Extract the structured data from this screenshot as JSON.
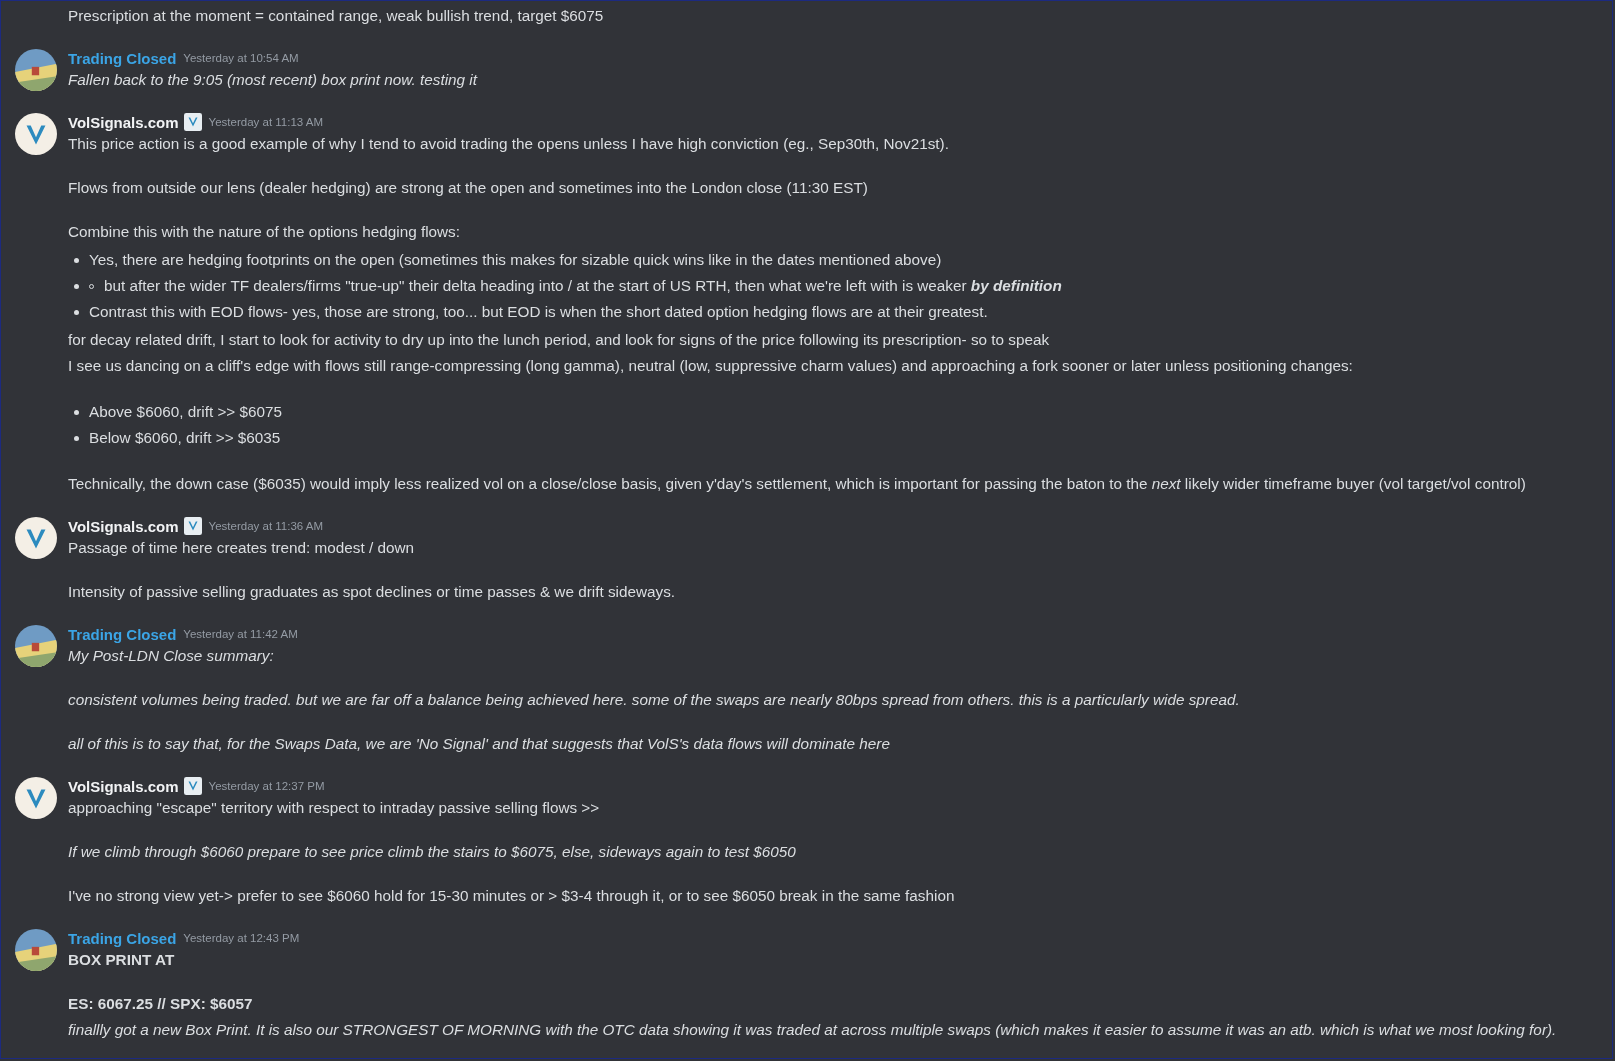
{
  "messages": [
    {
      "blocks": [
        {
          "kind": "plain",
          "text": "Prescription at the moment = contained range, weak bullish trend, target $6075"
        }
      ]
    },
    {
      "author": "Trading Closed",
      "color": "#3ba5e6",
      "verified": false,
      "time": "Yesterday at 10:54 AM",
      "blocks": [
        {
          "kind": "italic",
          "text": "Fallen back to the 9:05 (most recent) box print now. testing it"
        }
      ]
    },
    {
      "author": "VolSignals.com",
      "color": "#f2f3f5",
      "verified": true,
      "time": "Yesterday at 11:13 AM",
      "blocks": [
        {
          "kind": "plain",
          "text": "This price action is a good example of why I tend to avoid trading the opens unless I have high conviction (eg., Sep30th, Nov21st)."
        },
        {
          "kind": "gap"
        },
        {
          "kind": "plain",
          "text": "Flows from outside our lens (dealer hedging) are strong at the open and sometimes into the London close (11:30 EST)"
        },
        {
          "kind": "gap"
        },
        {
          "kind": "plain",
          "text": "Combine this with the nature of the options hedging flows:"
        },
        {
          "kind": "list",
          "items": [
            {
              "nested": false,
              "text": "Yes, there are hedging footprints on the open (sometimes this makes for sizable quick wins like in the dates mentioned above)"
            },
            {
              "nested": true,
              "text": "but after the wider TF dealers/firms \"true-up\" their delta heading into / at the start of US RTH, then what we're left with is weaker **by definition**"
            },
            {
              "nested": false,
              "text": "Contrast this with EOD flows- yes, those are strong, too... but EOD is when the short dated option hedging flows are at their greatest."
            }
          ]
        },
        {
          "kind": "plain",
          "text": "for decay related drift, I start to look for activity to dry up into the lunch period, and look for signs of the price following its prescription- so to speak"
        },
        {
          "kind": "plain",
          "text": "I see us dancing on a cliff's edge with flows still range-compressing (long gamma), neutral (low, suppressive charm values) and approaching a fork sooner or later unless positioning changes:"
        },
        {
          "kind": "gap"
        },
        {
          "kind": "list",
          "items": [
            {
              "nested": false,
              "text": "Above $6060, drift >> $6075"
            },
            {
              "nested": false,
              "text": "Below $6060, drift >> $6035"
            }
          ]
        },
        {
          "kind": "gap"
        },
        {
          "kind": "plain",
          "text": "Technically, the down case ($6035) would imply less realized vol on a close/close basis, given y'day's settlement, which is important for passing the baton to the *next* likely wider timeframe buyer (vol target/vol control)"
        }
      ]
    },
    {
      "author": "VolSignals.com",
      "color": "#f2f3f5",
      "verified": true,
      "time": "Yesterday at 11:36 AM",
      "blocks": [
        {
          "kind": "plain",
          "text": "Passage of time here creates trend: modest / down"
        },
        {
          "kind": "gap"
        },
        {
          "kind": "plain",
          "text": "Intensity of passive selling graduates as spot declines or time passes & we drift sideways."
        }
      ]
    },
    {
      "author": "Trading Closed",
      "color": "#3ba5e6",
      "verified": false,
      "time": "Yesterday at 11:42 AM",
      "blocks": [
        {
          "kind": "italic",
          "text": "My Post-LDN Close summary:"
        },
        {
          "kind": "gap"
        },
        {
          "kind": "italic",
          "text": "consistent volumes being traded. but we are far off a balance being achieved here. some of the swaps are nearly 80bps spread from others. this is a particularly wide spread."
        },
        {
          "kind": "gap"
        },
        {
          "kind": "italic",
          "text": "all of this is to say that, for the Swaps Data, we are 'No Signal' and that suggests that VolS's data flows will dominate here"
        }
      ]
    },
    {
      "author": "VolSignals.com",
      "color": "#f2f3f5",
      "verified": true,
      "time": "Yesterday at 12:37 PM",
      "blocks": [
        {
          "kind": "plain",
          "text": "approaching \"escape\" territory with respect to intraday passive selling flows >>"
        },
        {
          "kind": "gap"
        },
        {
          "kind": "italic",
          "text": "If we climb through $6060 prepare to see price climb the stairs to $6075, else, sideways again to test $6050"
        },
        {
          "kind": "gap"
        },
        {
          "kind": "plain",
          "text": "I've no strong view yet-> prefer to see $6060 hold for 15-30 minutes or > $3-4 through it, or to see $6050 break in the same fashion"
        }
      ]
    },
    {
      "author": "Trading Closed",
      "color": "#3ba5e6",
      "verified": false,
      "time": "Yesterday at 12:43 PM",
      "blocks": [
        {
          "kind": "bold",
          "text": "BOX PRINT AT"
        },
        {
          "kind": "gap"
        },
        {
          "kind": "bold",
          "text": "ES: 6067.25 // SPX: $6057"
        },
        {
          "kind": "italic",
          "text": "finallly got a new Box Print. It is also our STRONGEST OF MORNING with the OTC data showing it was traded at across multiple swaps (which makes it easier to assume it was an atb. which is what we most looking for)."
        }
      ]
    }
  ]
}
